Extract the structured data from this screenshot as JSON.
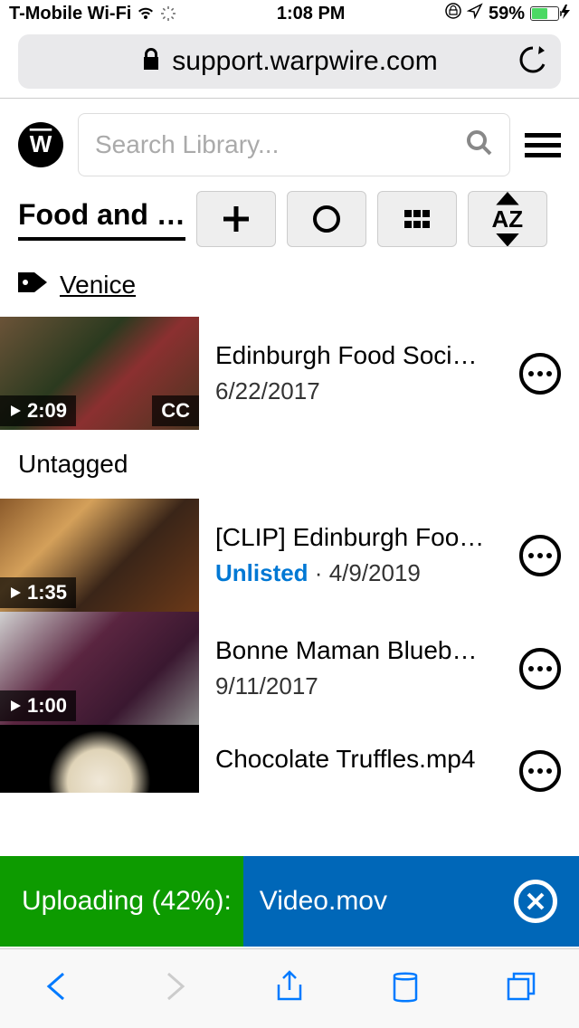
{
  "status_bar": {
    "carrier": "T-Mobile Wi-Fi",
    "time": "1:08 PM",
    "battery_pct": "59%"
  },
  "url_bar": {
    "domain": "support.warpwire.com"
  },
  "search": {
    "placeholder": "Search Library..."
  },
  "breadcrumb": "Food and …",
  "tag": {
    "label": "Venice"
  },
  "sections": {
    "untagged": "Untagged"
  },
  "videos": [
    {
      "title": "Edinburgh Food Soci…",
      "date": "6/22/2017",
      "duration": "2:09",
      "cc": "CC"
    },
    {
      "title": "[CLIP] Edinburgh Foo…",
      "date": "4/9/2019",
      "duration": "1:35",
      "unlisted": "Unlisted"
    },
    {
      "title": "Bonne Maman Blueb…",
      "date": "9/11/2017",
      "duration": "1:00"
    },
    {
      "title": "Chocolate Truffles.mp4",
      "date": ""
    }
  ],
  "upload": {
    "prefix": "Uploading (42%): ",
    "filename": "Video.mov",
    "progress_pct": 42
  },
  "sort_label": "AZ"
}
